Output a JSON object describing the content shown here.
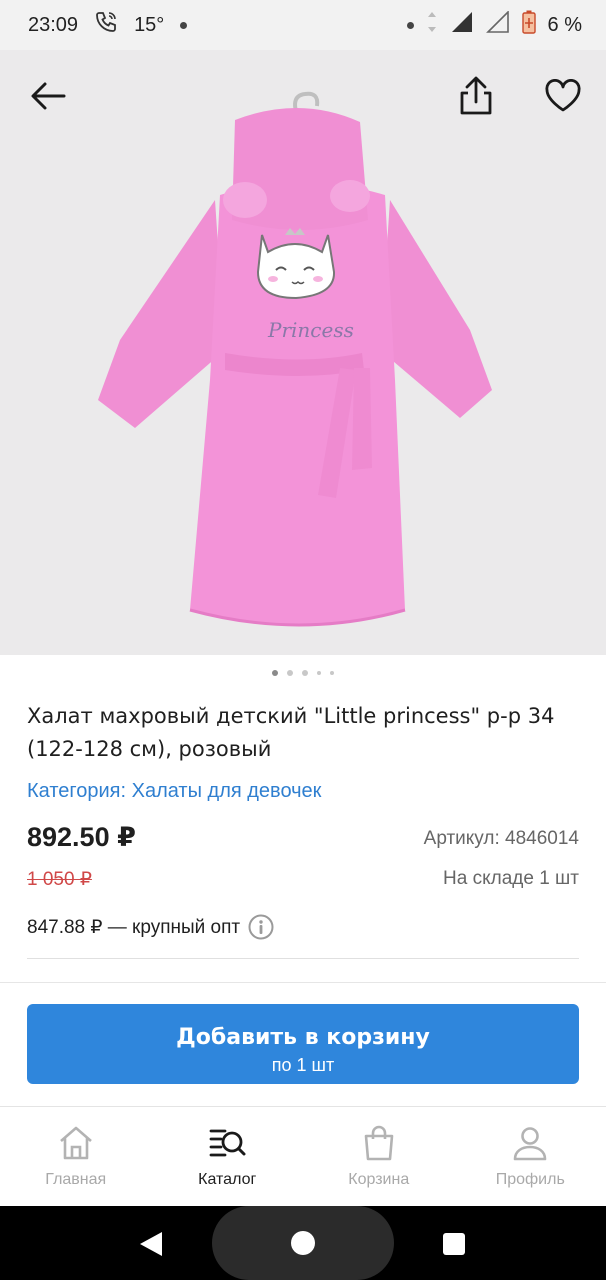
{
  "status_bar": {
    "time": "23:09",
    "temperature": "15°",
    "battery": "6 %"
  },
  "gallery": {
    "back_icon": "arrow-left-icon",
    "share_icon": "share-icon",
    "favorite_icon": "heart-icon",
    "robe_print_text": "Princess",
    "page_count": 5,
    "active_page": 1
  },
  "product": {
    "title": "Халат махровый детский \"Little princess\" р-р 34 (122-128 см), розовый",
    "category": "Категория: Халаты для девочек",
    "price": "892.50 ₽",
    "old_price": "1 050 ₽",
    "sku": "Артикул: 4846014",
    "stock": "На складе 1 шт",
    "wholesale": "847.88 ₽ — крупный опт"
  },
  "cart_button": {
    "label": "Добавить в корзину",
    "sublabel": "по 1 шт"
  },
  "bottom_nav": {
    "items": [
      {
        "label": "Главная",
        "icon": "home-icon"
      },
      {
        "label": "Каталог",
        "icon": "catalog-search-icon"
      },
      {
        "label": "Корзина",
        "icon": "bag-icon"
      },
      {
        "label": "Профиль",
        "icon": "profile-icon"
      }
    ]
  },
  "colors": {
    "accent": "#2f86dc",
    "link": "#2f7fd0",
    "old_price": "#d04848",
    "robe_pink": "#f08fd3"
  }
}
